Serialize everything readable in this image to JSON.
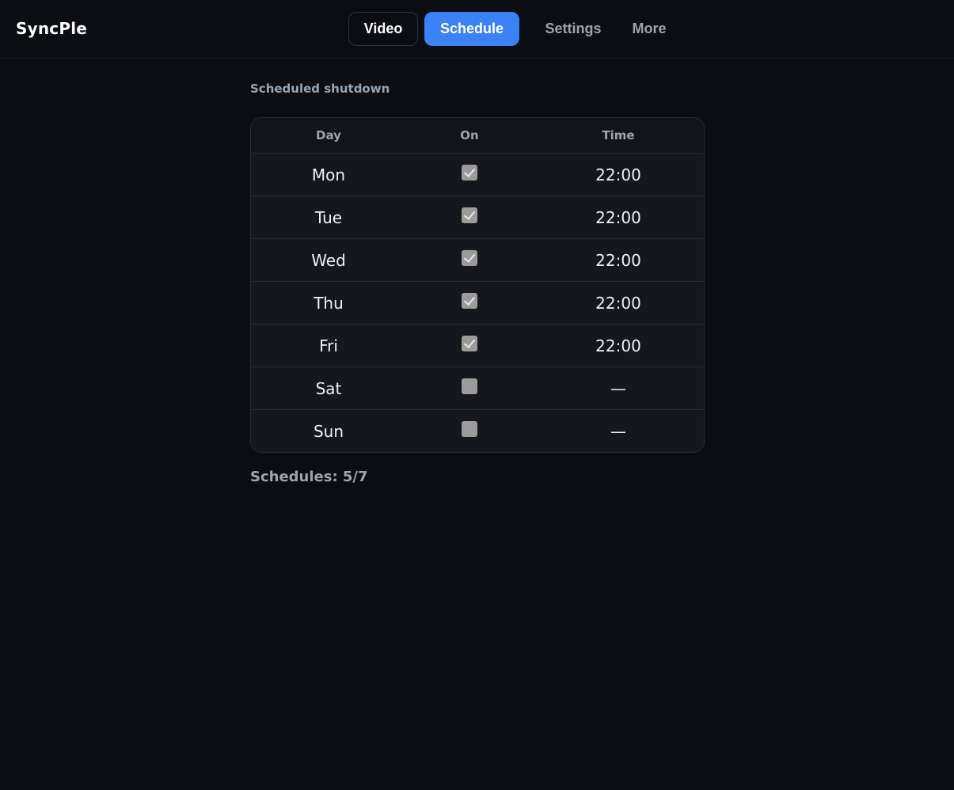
{
  "app": {
    "title": "SyncPle"
  },
  "nav": {
    "tabs": [
      {
        "label": "Video"
      },
      {
        "label": "Schedule"
      },
      {
        "label": "Settings"
      },
      {
        "label": "More"
      }
    ],
    "active": "Schedule"
  },
  "schedule": {
    "section_title": "Scheduled shutdown",
    "columns": [
      "Day",
      "On",
      "Time"
    ],
    "rows": [
      {
        "day": "Mon",
        "on": true,
        "time": "22:00"
      },
      {
        "day": "Tue",
        "on": true,
        "time": "22:00"
      },
      {
        "day": "Wed",
        "on": true,
        "time": "22:00"
      },
      {
        "day": "Thu",
        "on": true,
        "time": "22:00"
      },
      {
        "day": "Fri",
        "on": true,
        "time": "22:00"
      },
      {
        "day": "Sat",
        "on": false,
        "time": "—"
      },
      {
        "day": "Sun",
        "on": false,
        "time": "—"
      }
    ],
    "summary": "Schedules: 5/7"
  },
  "colors": {
    "accent": "#3b82f6",
    "background": "#0b0d12",
    "muted_text": "#9aa4b2"
  }
}
